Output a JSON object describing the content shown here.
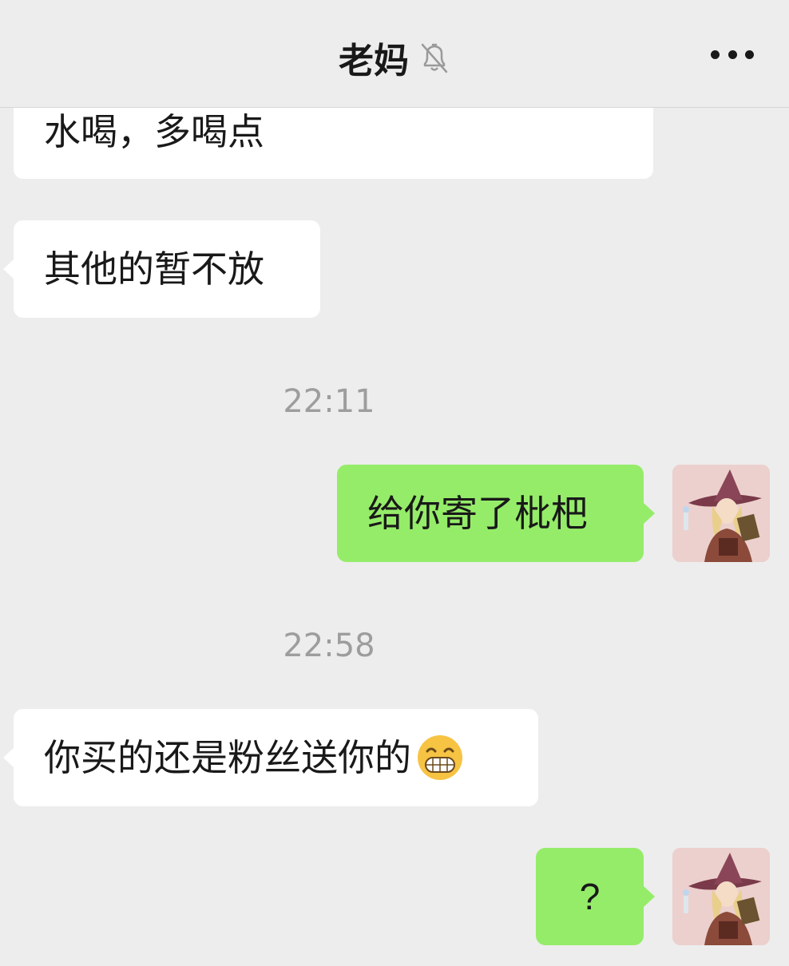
{
  "header": {
    "title": "老妈",
    "mute_icon": "bell-off-icon",
    "more_icon": "more-dots-icon"
  },
  "messages": [
    {
      "side": "in",
      "text": "水喝，多喝点"
    },
    {
      "side": "in",
      "text": "其他的暂不放"
    },
    {
      "side": "out",
      "text": "给你寄了枇杷",
      "avatar": "witch-avatar"
    },
    {
      "side": "in",
      "text": "你买的还是粉丝送你的",
      "emoji": "grinning-face-emoji"
    },
    {
      "side": "out",
      "text": "?",
      "avatar": "witch-avatar"
    }
  ],
  "timestamps": [
    "22:11",
    "22:58"
  ],
  "colors": {
    "background": "#ededed",
    "incoming_bubble": "#ffffff",
    "outgoing_bubble": "#95ec69",
    "timestamp_text": "#9d9d9d"
  }
}
